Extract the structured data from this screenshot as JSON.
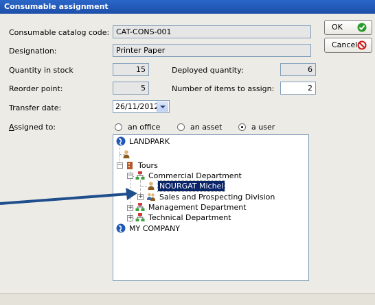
{
  "window": {
    "title": "Consumable assignment"
  },
  "form": {
    "catalog_code_label": "Consumable catalog code:",
    "catalog_code_value": "CAT-CONS-001",
    "designation_label": "Designation:",
    "designation_value": "Printer Paper",
    "quantity_stock_label": "Quantity in stock",
    "quantity_stock_value": "15",
    "deployed_label": "Deployed quantity:",
    "deployed_value": "6",
    "reorder_label": "Reorder point:",
    "reorder_value": "5",
    "items_assign_label": "Number of items to assign:",
    "items_assign_value": "2",
    "transfer_label": "Transfer date:",
    "transfer_value": "26/11/2012",
    "assigned_label_underlined": "A",
    "assigned_label_rest": "ssigned to:",
    "radio_office": "an office",
    "radio_asset": "an asset",
    "radio_user": "a user",
    "selected_radio": "a user"
  },
  "buttons": {
    "ok": "OK",
    "cancel": "Cancel"
  },
  "tree": {
    "landpark": "LANDPARK",
    "tours": "Tours",
    "commercial": "Commercial Department",
    "nourgat": "NOURGAT Michel",
    "sales": "Sales and Prospecting Division",
    "management": "Management Department",
    "technical": "Technical Department",
    "mycompany": "MY COMPANY"
  },
  "icons": {
    "ok": "check-icon",
    "cancel": "no-entry-icon",
    "globe": "globe-icon",
    "user": "user-icon",
    "building": "building-icon",
    "department": "department-icon",
    "group": "group-icon"
  },
  "colors": {
    "title_bar": "#1d4fa8",
    "selection": "#0a246a",
    "arrow": "#1f4e8c"
  }
}
